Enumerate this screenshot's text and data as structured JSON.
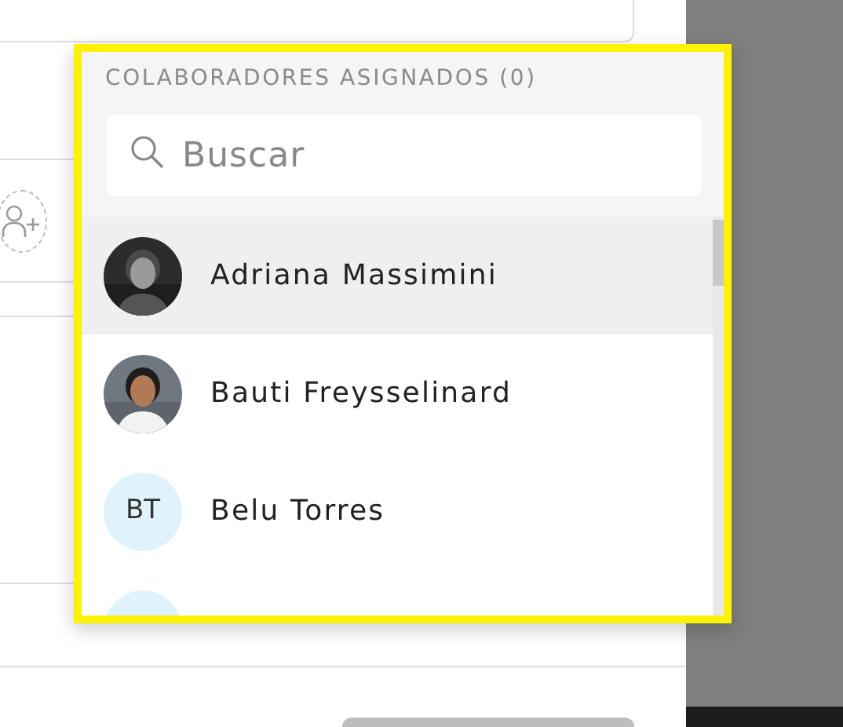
{
  "dropdown": {
    "header": "COLABORADORES ASIGNADOS (0)",
    "search": {
      "placeholder": "Buscar"
    },
    "people": [
      {
        "name": "Adriana Massimini",
        "selected": true
      },
      {
        "name": "Bauti Freysselinard",
        "selected": false
      },
      {
        "name": "Belu Torres",
        "kind": "initials",
        "initials": "BT",
        "selected": false
      },
      {
        "kind": "initials",
        "selected": false
      }
    ]
  }
}
